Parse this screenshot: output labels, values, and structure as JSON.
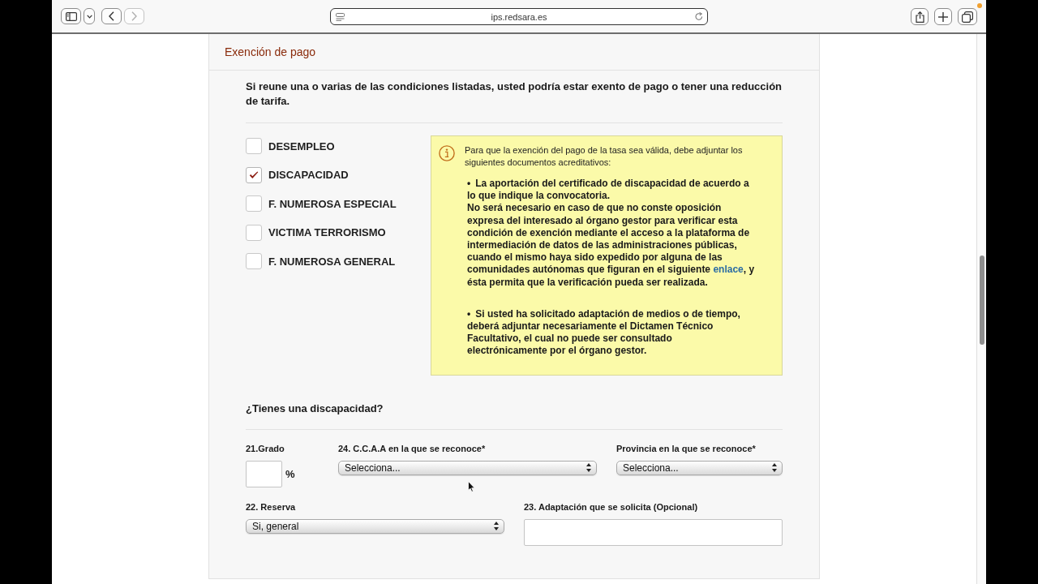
{
  "browser": {
    "url": "ips.redsara.es",
    "nav_buttons": [
      {
        "kind": "back",
        "disabled": false
      },
      {
        "kind": "forward",
        "disabled": true
      }
    ]
  },
  "panel": {
    "title": "Exención de pago",
    "intro": "Si reune una o varias de las condiciones listadas, usted podría estar exento de pago o tener una reducción de tarifa.",
    "conditions": [
      {
        "label": "DESEMPLEO",
        "checked": false
      },
      {
        "label": "DISCAPACIDAD",
        "checked": true
      },
      {
        "label": "F. NUMEROSA ESPECIAL",
        "checked": false
      },
      {
        "label": "VICTIMA TERRORISMO",
        "checked": false
      },
      {
        "label": "F. NUMEROSA GENERAL",
        "checked": false
      }
    ],
    "notice": {
      "intro": "Para que la exención del pago de la tasa sea válida, debe adjuntar los siguientes documentos acreditativos:",
      "items": [
        {
          "bullet": "•",
          "text": "La aportación del certificado de discapacidad de acuerdo a lo que indique la convocatoria.",
          "before_link": "No será necesario en caso de que no conste oposición expresa del interesado al órgano gestor para verificar esta condición de exención mediante el acceso a la plataforma de intermediación de datos de las administraciones públicas, cuando el mismo haya sido expedido por alguna de las comunidades autónomas que figuran en el siguiente",
          "link": "enlace",
          "after_link": ", y ésta permita que la verificación pueda ser realizada."
        },
        {
          "bullet": "•",
          "text": "Si usted ha solicitado adaptación de medios o de tiempo, deberá adjuntar necesariamente el Dictamen Técnico Facultativo, el cual no puede ser consultado electrónicamente por el órgano gestor."
        }
      ]
    },
    "disability": {
      "question": "¿Tienes una discapacidad?",
      "rows": [
        [
          {
            "label": "21.Grado",
            "kind": "text",
            "suffix": "%"
          },
          {
            "label": "24. C.C.A.A en la que se reconoce*",
            "kind": "select",
            "value": "Selecciona..."
          },
          {
            "label": "Provincia en la que se reconoce*",
            "kind": "select",
            "value": "Selecciona..."
          }
        ],
        [
          {
            "label": "22. Reserva",
            "kind": "select",
            "value": "Si, general"
          },
          {
            "label": "23. Adaptación que se solicita (Opcional)",
            "kind": "text"
          }
        ]
      ]
    }
  }
}
